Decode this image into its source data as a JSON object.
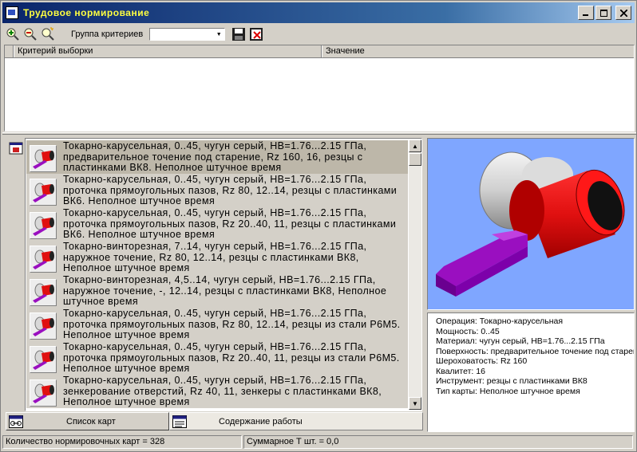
{
  "window": {
    "title": "Трудовое нормирование"
  },
  "toolbar": {
    "group_label": "Группа критериев",
    "group_value": ""
  },
  "criteria_table": {
    "columns": [
      "Критерий выборки",
      "Значение"
    ]
  },
  "cards": [
    {
      "text": "Токарно-карусельная, 0..45, чугун серый, НВ=1.76...2.15 ГПа, предварительное точение под старение, Rz 160, 16, резцы с пластинками ВК8. Неполное штучное время",
      "selected": true
    },
    {
      "text": "Токарно-карусельная, 0..45, чугун серый, НВ=1.76...2.15 ГПа, проточка прямоугольных пазов, Rz 80, 12..14, резцы с пластинками ВК6. Неполное штучное время",
      "selected": false
    },
    {
      "text": "Токарно-карусельная, 0..45, чугун серый, НВ=1.76...2.15 ГПа, проточка прямоугольных пазов, Rz 20..40, 11, резцы с пластинками ВК6. Неполное штучное время",
      "selected": false
    },
    {
      "text": "Токарно-винторезная, 7..14, чугун серый, НВ=1.76...2.15 ГПа, наружное точение, Rz 80, 12..14, резцы с пластинками ВК8, Неполное штучное время",
      "selected": false
    },
    {
      "text": "Токарно-винторезная, 4,5..14, чугун серый, НВ=1.76...2.15 ГПа, наружное точение, -, 12..14, резцы с пластинками ВК8, Неполное штучное время",
      "selected": false
    },
    {
      "text": "Токарно-карусельная, 0..45, чугун серый, НВ=1.76...2.15 ГПа, проточка прямоугольных пазов, Rz 80, 12..14, резцы из стали Р6М5. Неполное штучное время",
      "selected": false
    },
    {
      "text": "Токарно-карусельная, 0..45, чугун серый, НВ=1.76...2.15 ГПа, проточка прямоугольных пазов, Rz 20..40, 11, резцы из стали Р6М5. Неполное штучное время",
      "selected": false
    },
    {
      "text": "Токарно-карусельная, 0..45, чугун серый, НВ=1.76...2.15 ГПа, зенкерование отверстий, Rz 40, 11, зенкеры с пластинками ВК8, Неполное штучное время",
      "selected": false
    }
  ],
  "tabs": {
    "cards_list": "Список карт",
    "work_content": "Содержание работы"
  },
  "info": {
    "lines": [
      "Операция: Токарно-карусельная",
      "Мощность: 0..45",
      "Материал: чугун серый, НВ=1.76...2.15 ГПа",
      "Поверхность: предварительное точение под старение",
      "Шероховатость: Rz 160",
      "Квалитет: 16",
      "Инструмент: резцы с пластинками ВК8",
      "Тип карты: Неполное штучное время"
    ]
  },
  "status": {
    "cards_count": "Количество нормировочных карт = 328",
    "total_time": "Суммарное Т шт. = 0,0"
  },
  "colors": {
    "title_gradient_start": "#0a246a",
    "title_text": "#ffff40",
    "preview_bg": "#7fa6ff",
    "part_red": "#ee1111",
    "tool_purple": "#9a0fc0"
  }
}
